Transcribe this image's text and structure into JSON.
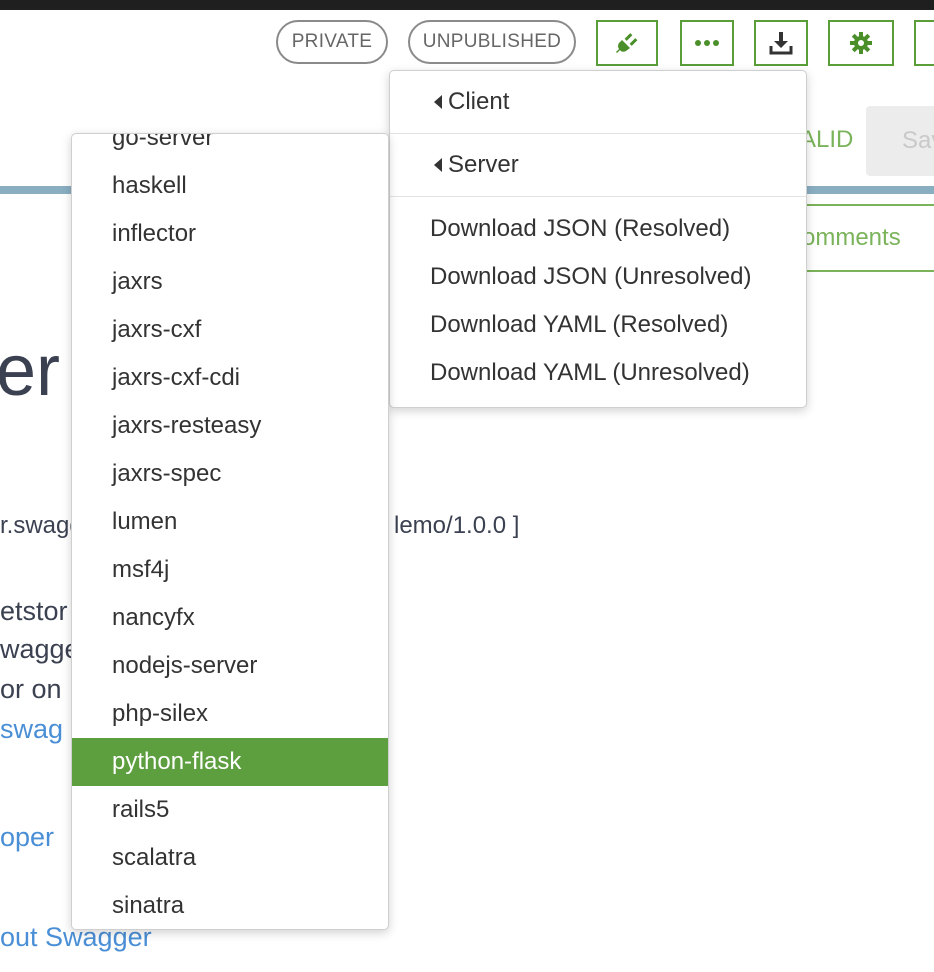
{
  "header": {
    "private_label": "PRIVATE",
    "unpublished_label": "UNPUBLISHED",
    "toolbar_icons": [
      "plug-icon",
      "ellipsis-icon",
      "download-icon",
      "gear-icon"
    ]
  },
  "background": {
    "valid_label": "ALID",
    "save_label": "Sav",
    "comments_tab": "omments",
    "big_title": "er",
    "url_left": "r.swagg",
    "url_right": "lemo/1.0.0 ]",
    "desc_line1": "etstor",
    "desc_line2": "wagge",
    "desc_line3": "or on",
    "link_line": "swag",
    "link_developer": "oper",
    "link_about": "out Swagger"
  },
  "download_menu": {
    "client_label": "Client",
    "server_label": "Server",
    "items": [
      "Download JSON (Resolved)",
      "Download JSON (Unresolved)",
      "Download YAML (Resolved)",
      "Download YAML (Unresolved)"
    ]
  },
  "server_menu": {
    "selected": "python-flask",
    "items": [
      "go-server",
      "haskell",
      "inflector",
      "jaxrs",
      "jaxrs-cxf",
      "jaxrs-cxf-cdi",
      "jaxrs-resteasy",
      "jaxrs-spec",
      "lumen",
      "msf4j",
      "nancyfx",
      "nodejs-server",
      "php-silex",
      "python-flask",
      "rails5",
      "scalatra",
      "sinatra"
    ]
  },
  "colors": {
    "accent_green": "#5d9e3f",
    "link_blue": "#4a8fd6",
    "divider_blue": "#89aec2"
  }
}
